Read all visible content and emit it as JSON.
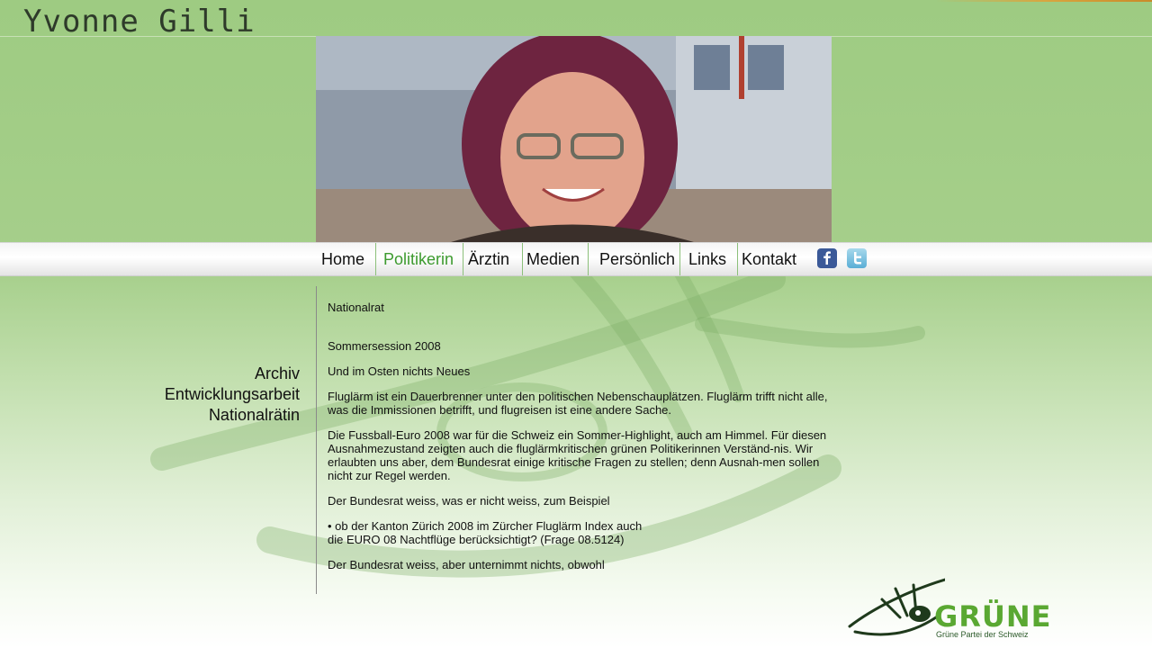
{
  "site": {
    "title": "Yvonne Gilli"
  },
  "hero": {
    "alt": "Portrait of Yvonne Gilli"
  },
  "nav": {
    "items": [
      {
        "label": "Home",
        "active": false
      },
      {
        "label": "Politikerin",
        "active": true
      },
      {
        "label": "Ärztin",
        "active": false
      },
      {
        "label": "Medien",
        "active": false
      },
      {
        "label": "Persönlich",
        "active": false
      },
      {
        "label": "Links",
        "active": false
      },
      {
        "label": "Kontakt",
        "active": false
      }
    ],
    "social": [
      {
        "icon": "facebook-icon",
        "glyph": "f"
      },
      {
        "icon": "twitter-icon",
        "glyph": "t"
      }
    ],
    "active_color": "#3c9a2e"
  },
  "sidebar": {
    "items": [
      {
        "label": "Archiv"
      },
      {
        "label": "Entwicklungsarbeit"
      },
      {
        "label": "Nationalrätin"
      }
    ]
  },
  "content": {
    "section": "Nationalrat",
    "session": "Sommersession 2008",
    "headline": "Und im Osten nichts Neues",
    "para1": "Fluglärm ist ein Dauerbrenner unter den politischen Nebenschauplätzen. Fluglärm trifft nicht alle, was die Immissionen betrifft, und flugreisen ist eine andere Sache.",
    "para2": "Die Fussball-Euro 2008 war für die Schweiz ein Sommer-Highlight, auch am Himmel. Für diesen Ausnahmezustand zeigten auch die fluglärmkritischen grünen Politikerinnen Verständ-nis. Wir erlaubten uns aber, dem Bundesrat einige kritische Fragen zu stellen; denn Ausnah-men sollen nicht zur Regel werden.",
    "para3": "Der Bundesrat weiss, was er nicht weiss, zum Beispiel",
    "bullet_line1": "• ob der Kanton Zürich 2008 im Zürcher Fluglärm Index auch",
    "bullet_line2": "die EURO 08 Nachtflüge berücksichtigt? (Frage 08.5124)",
    "para4": "Der Bundesrat weiss, aber unternimmt nichts, obwohl"
  },
  "logo": {
    "name": "GRÜNE",
    "subtitle": "Grüne Partei der Schweiz",
    "color": "#5aa832"
  }
}
